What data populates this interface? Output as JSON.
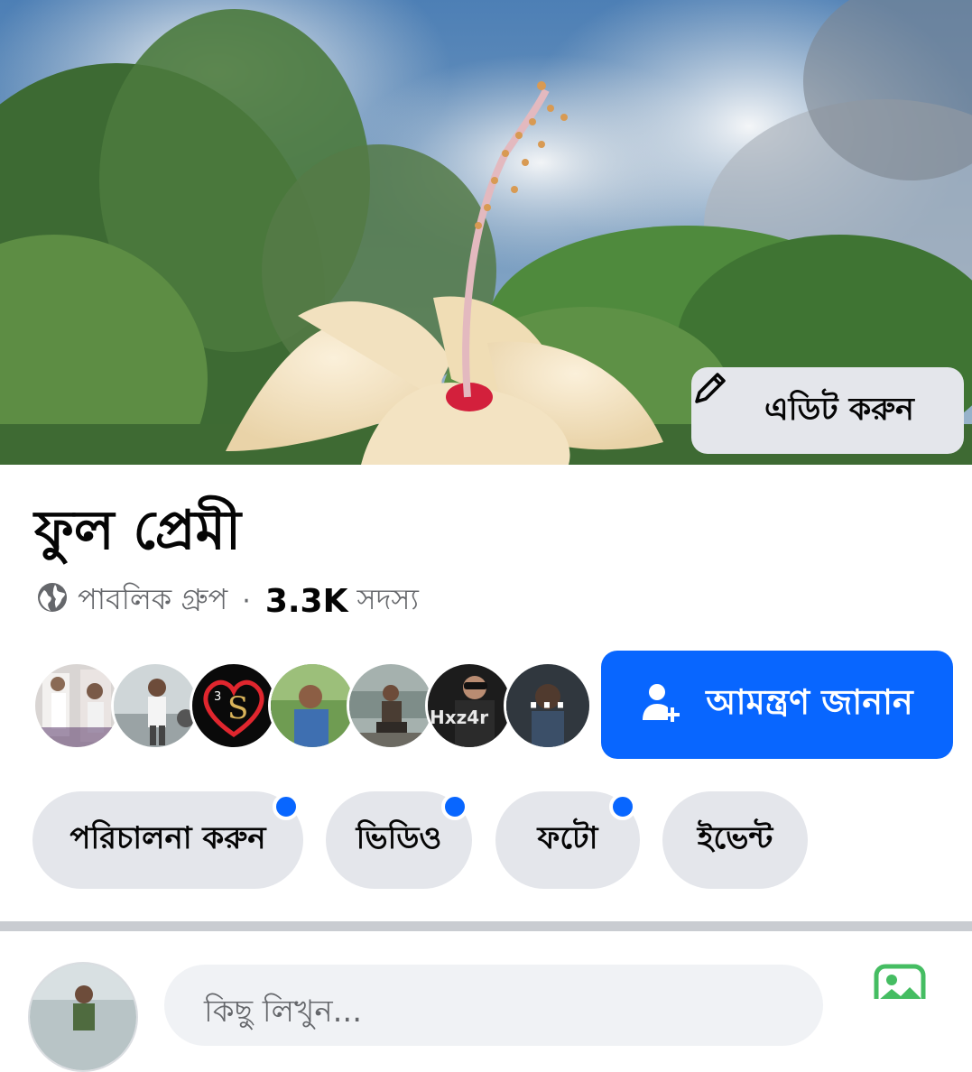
{
  "cover": {
    "edit_label": "এডিট করুন"
  },
  "group": {
    "title": "ফুল প্রেমী",
    "privacy": "পাবলিক গ্রুপ",
    "separator": "·",
    "member_count": "3.3K",
    "member_label": "সদস্য"
  },
  "members": {
    "more_label": "···"
  },
  "invite": {
    "label": "আমন্ত্রণ জানান"
  },
  "chips": [
    {
      "label": "পরিচালনা করুন",
      "badge": true
    },
    {
      "label": "ভিডিও",
      "badge": true
    },
    {
      "label": "ফটো",
      "badge": true
    },
    {
      "label": "ইভেন্ট",
      "badge": false
    }
  ],
  "composer": {
    "placeholder": "কিছু লিখুন..."
  },
  "colors": {
    "primary": "#0866ff",
    "chip_bg": "#e4e6eb",
    "secondary_text": "#65676b",
    "photo_icon": "#45bd62"
  }
}
